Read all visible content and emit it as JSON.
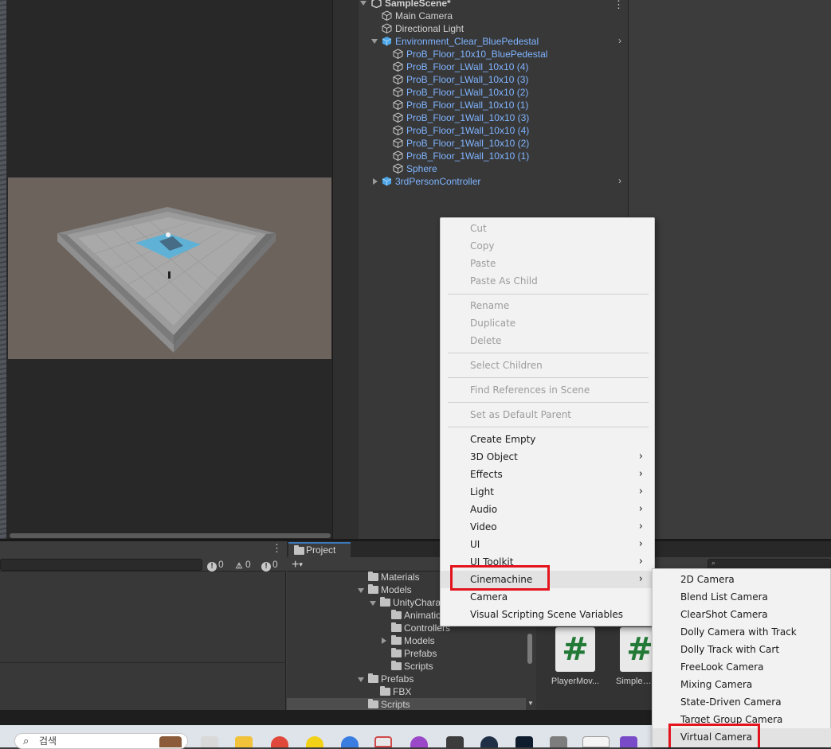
{
  "hierarchy": {
    "scene_name": "SampleScene*",
    "items": [
      {
        "label": "Main Camera"
      },
      {
        "label": "Directional Light"
      },
      {
        "label": "Environment_Clear_BluePedestal"
      },
      {
        "label": "ProB_Floor_10x10_BluePedestal"
      },
      {
        "label": "ProB_Floor_LWall_10x10 (4)"
      },
      {
        "label": "ProB_Floor_LWall_10x10 (3)"
      },
      {
        "label": "ProB_Floor_LWall_10x10 (2)"
      },
      {
        "label": "ProB_Floor_LWall_10x10 (1)"
      },
      {
        "label": "ProB_Floor_1Wall_10x10 (3)"
      },
      {
        "label": "ProB_Floor_1Wall_10x10 (4)"
      },
      {
        "label": "ProB_Floor_1Wall_10x10 (2)"
      },
      {
        "label": "ProB_Floor_1Wall_10x10 (1)"
      },
      {
        "label": "Sphere"
      },
      {
        "label": "3rdPersonController"
      }
    ]
  },
  "context_menu": {
    "items": [
      {
        "label": "Cut",
        "enabled": false
      },
      {
        "label": "Copy",
        "enabled": false
      },
      {
        "label": "Paste",
        "enabled": false
      },
      {
        "label": "Paste As Child",
        "enabled": false
      },
      {
        "label": "Rename",
        "enabled": false
      },
      {
        "label": "Duplicate",
        "enabled": false
      },
      {
        "label": "Delete",
        "enabled": false
      },
      {
        "label": "Select Children",
        "enabled": false
      },
      {
        "label": "Find References in Scene",
        "enabled": false
      },
      {
        "label": "Set as Default Parent",
        "enabled": false
      },
      {
        "label": "Create Empty",
        "enabled": true
      },
      {
        "label": "3D Object",
        "enabled": true,
        "submenu": true
      },
      {
        "label": "Effects",
        "enabled": true,
        "submenu": true
      },
      {
        "label": "Light",
        "enabled": true,
        "submenu": true
      },
      {
        "label": "Audio",
        "enabled": true,
        "submenu": true
      },
      {
        "label": "Video",
        "enabled": true,
        "submenu": true
      },
      {
        "label": "UI",
        "enabled": true,
        "submenu": true
      },
      {
        "label": "UI Toolkit",
        "enabled": true,
        "submenu": true
      },
      {
        "label": "Cinemachine",
        "enabled": true,
        "submenu": true,
        "highlighted": true
      },
      {
        "label": "Camera",
        "enabled": true
      },
      {
        "label": "Visual Scripting Scene Variables",
        "enabled": true
      }
    ]
  },
  "cinemachine_submenu": {
    "items": [
      {
        "label": "2D Camera"
      },
      {
        "label": "Blend List Camera"
      },
      {
        "label": "ClearShot Camera"
      },
      {
        "label": "Dolly Camera with Track"
      },
      {
        "label": "Dolly Track with Cart"
      },
      {
        "label": "FreeLook Camera"
      },
      {
        "label": "Mixing Camera"
      },
      {
        "label": "State-Driven Camera"
      },
      {
        "label": "Target Group Camera"
      },
      {
        "label": "Virtual Camera",
        "highlighted": true
      }
    ]
  },
  "console": {
    "error_count": "0",
    "warning_count": "0",
    "message_count": "0"
  },
  "project": {
    "tab_label": "Project",
    "tree": [
      {
        "label": "Materials"
      },
      {
        "label": "Models"
      },
      {
        "label": "UnityChara"
      },
      {
        "label": "Animatio"
      },
      {
        "label": "Controllers"
      },
      {
        "label": "Models"
      },
      {
        "label": "Prefabs"
      },
      {
        "label": "Scripts"
      },
      {
        "label": "Prefabs"
      },
      {
        "label": "FBX"
      },
      {
        "label": "Scripts"
      }
    ],
    "files": [
      {
        "label": "PlayerMov..."
      },
      {
        "label": "SimpleEle"
      }
    ]
  },
  "taskbar": {
    "search_text": "검색"
  },
  "colors": {
    "accent_red": "#e3141d",
    "prefab_blue": "#7fb4ff",
    "script_green": "#237a36"
  }
}
